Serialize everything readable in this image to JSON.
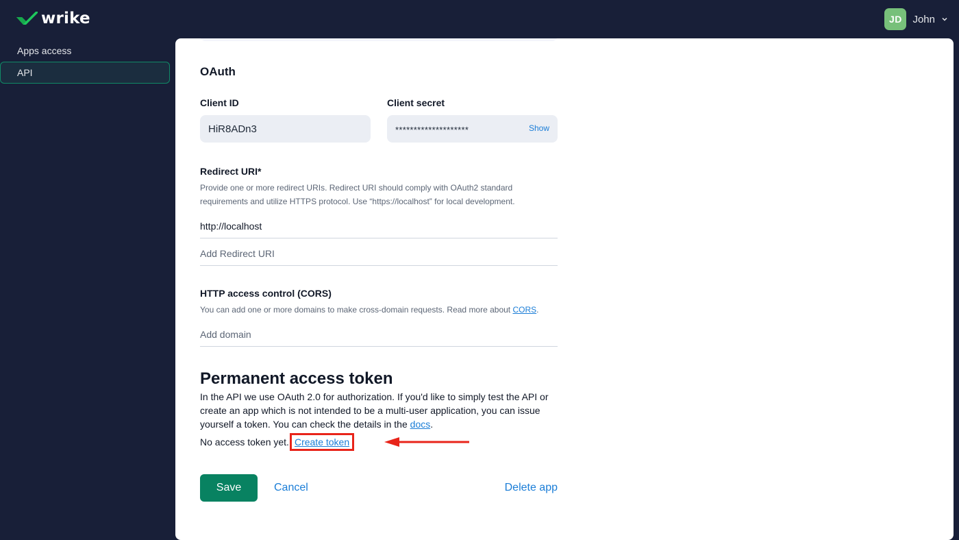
{
  "app": {
    "brand": "wrike",
    "brand_color": "#1ec85c",
    "accent_color": "#088261",
    "link_color": "#1a7dd7"
  },
  "user": {
    "initials": "JD",
    "name": "John",
    "avatar_color": "#77c07a"
  },
  "sidebar": {
    "items": [
      {
        "label": "Apps access",
        "active": false
      },
      {
        "label": "API",
        "active": true
      }
    ]
  },
  "oauth": {
    "title": "OAuth",
    "client_id_label": "Client ID",
    "client_id_value": "HiR8ADn3",
    "client_secret_label": "Client secret",
    "client_secret_value": "********************",
    "show_label": "Show",
    "redirect_label": "Redirect URI*",
    "redirect_help_line1": "Provide one or more redirect URIs. Redirect URI should comply with OAuth2 standard",
    "redirect_help_line2": "requirements and utilize HTTPS protocol. Use “https://localhost” for local development.",
    "redirect_uris": [
      "http://localhost"
    ],
    "add_redirect_placeholder": "Add Redirect URI",
    "cors_label": "HTTP access control (CORS)",
    "cors_help_prefix": "You can add one or more domains to make cross-domain requests. Read more about ",
    "cors_link": "CORS",
    "cors_help_suffix": ".",
    "add_domain_placeholder": "Add domain"
  },
  "token": {
    "title": "Permanent access token",
    "description": "In the API we use OAuth 2.0 for authorization. If you'd like to simply test the API or create an app which is not intended to be a multi-user application, you can issue yourself a token. You can check the details in the ",
    "docs_link": "docs",
    "description_suffix": ".",
    "status": "No access token yet.",
    "create_label": "Create token",
    "annotation_color": "#e8241a"
  },
  "actions": {
    "save": "Save",
    "cancel": "Cancel",
    "delete": "Delete app"
  }
}
